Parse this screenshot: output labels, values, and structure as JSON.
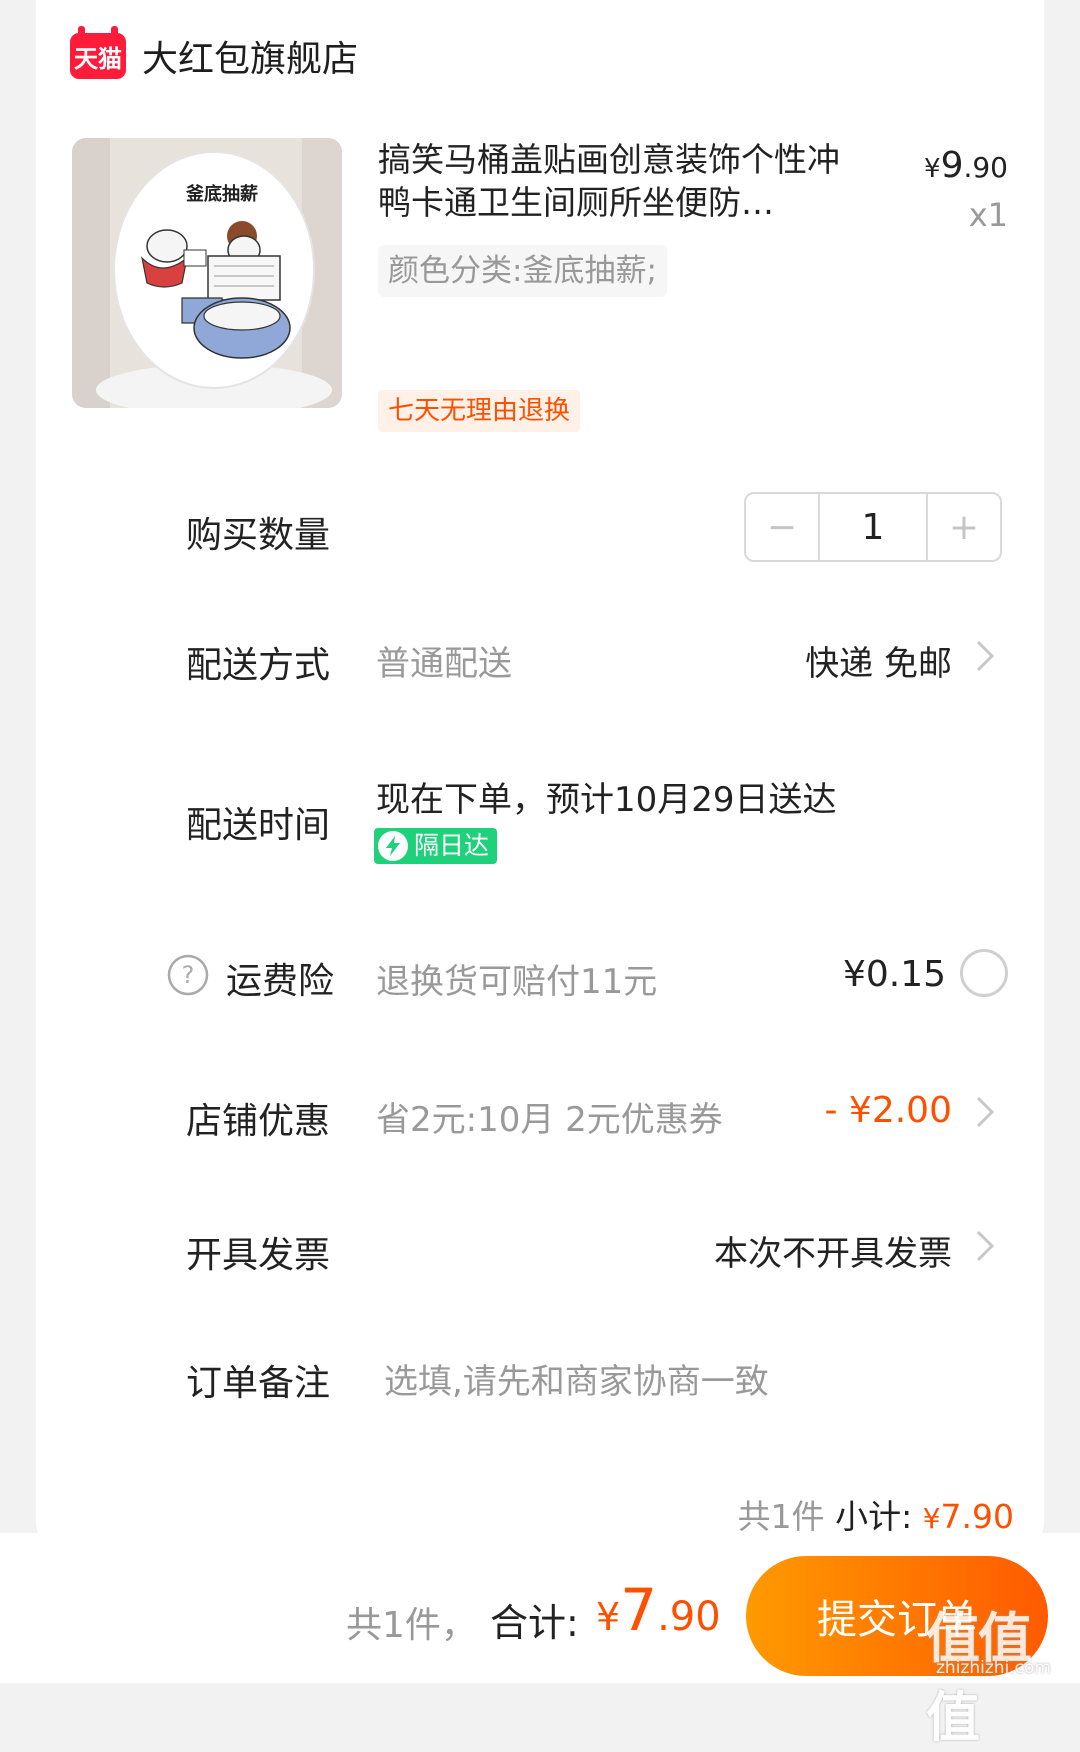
{
  "store": {
    "badge_text": "天猫",
    "name": "大红包旗舰店"
  },
  "product": {
    "image_caption": "釜底抽薪",
    "title": "搞笑马桶盖贴画创意装饰个性冲鸭卡通卫生间厕所坐便防…",
    "price_symbol": "¥",
    "price_int": "9",
    "price_dec": ".90",
    "quantity_mult": "x1",
    "spec": "颜色分类:釜底抽薪;",
    "return_tag": "七天无理由退换"
  },
  "quantity": {
    "label": "购买数量",
    "minus": "−",
    "value": "1",
    "plus": "+"
  },
  "delivery": {
    "label": "配送方式",
    "method": "普通配送",
    "value": "快递 免邮"
  },
  "delivery_time": {
    "label": "配送时间",
    "text": "现在下单，预计10月29日送达",
    "badge": "隔日达"
  },
  "insurance": {
    "label": "运费险",
    "desc": "退换货可赔付11元",
    "price": "¥0.15"
  },
  "store_discount": {
    "label": "店铺优惠",
    "desc": "省2元:10月 2元优惠券",
    "value": "- ¥2.00"
  },
  "invoice": {
    "label": "开具发票",
    "value": "本次不开具发票"
  },
  "remark": {
    "label": "订单备注",
    "placeholder": "选填,请先和商家协商一致"
  },
  "subtotal": {
    "count": "共1件",
    "label": "小计:",
    "symbol": "¥",
    "int": "7",
    "dec": ".90"
  },
  "footer": {
    "count": "共1件，",
    "total_label": "合计:",
    "symbol": "¥",
    "int": "7",
    "dec": ".90",
    "submit": "提交订单"
  },
  "watermark": {
    "text": "值值值",
    "url": "zhizhizhi.com"
  },
  "colors": {
    "accent": "#ff5000",
    "tmall_red": "#ff1c3b",
    "next_day_green": "#1fd17a"
  }
}
